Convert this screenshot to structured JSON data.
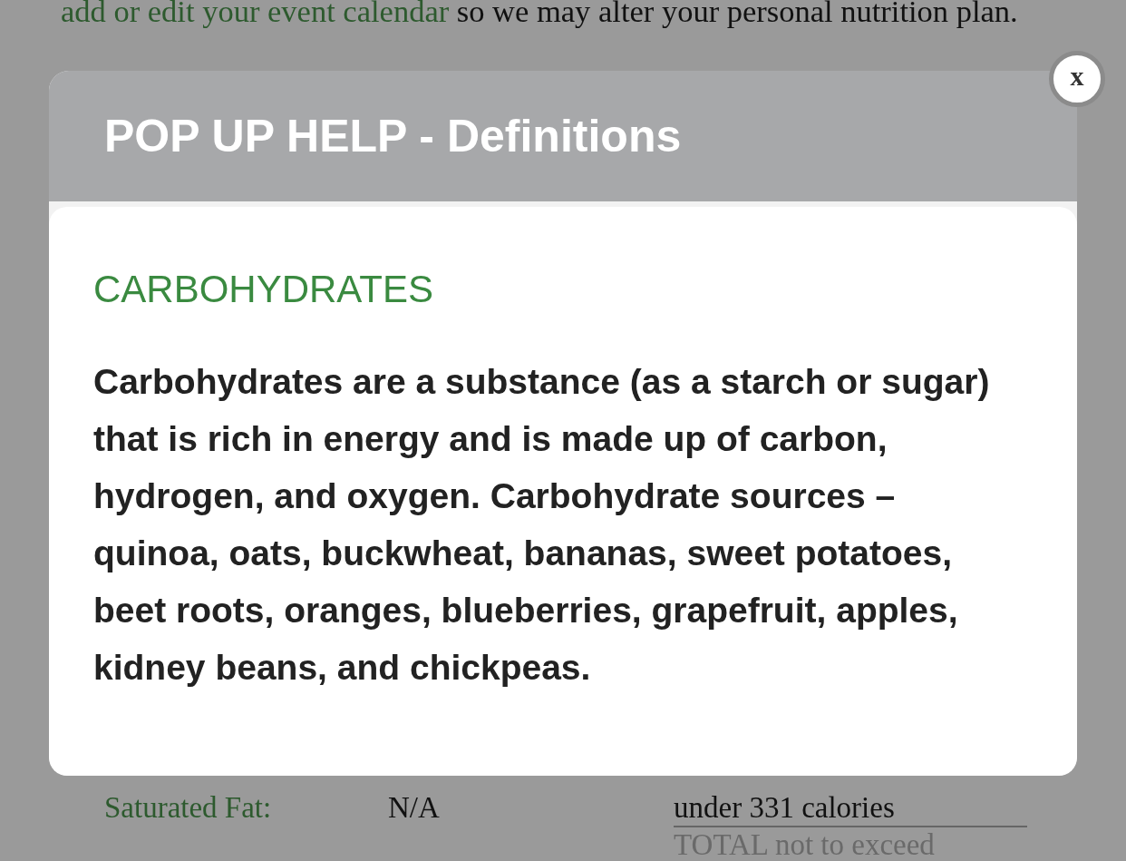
{
  "page": {
    "intro": {
      "link": "add or edit your event calendar",
      "text": "so we may alter your personal nutrition plan."
    },
    "nutrients": [
      {
        "label": "Saturated Fat:",
        "value": "N/A",
        "limit": "under 331 calories"
      }
    ],
    "total_label": "TOTAL not to exceed"
  },
  "dialog": {
    "title": "POP UP HELP - Definitions",
    "close_button": "x",
    "term": "CARBOHYDRATES",
    "definition": "Carbohydrates are a substance (as a starch or sugar) that is rich in energy and is made up of carbon, hydrogen, and oxygen. Carbohydrate sources – quinoa, oats, buckwheat, bananas, sweet potatoes, beet roots, oranges, blueberries, grapefruit, apples, kidney beans, and chickpeas."
  }
}
